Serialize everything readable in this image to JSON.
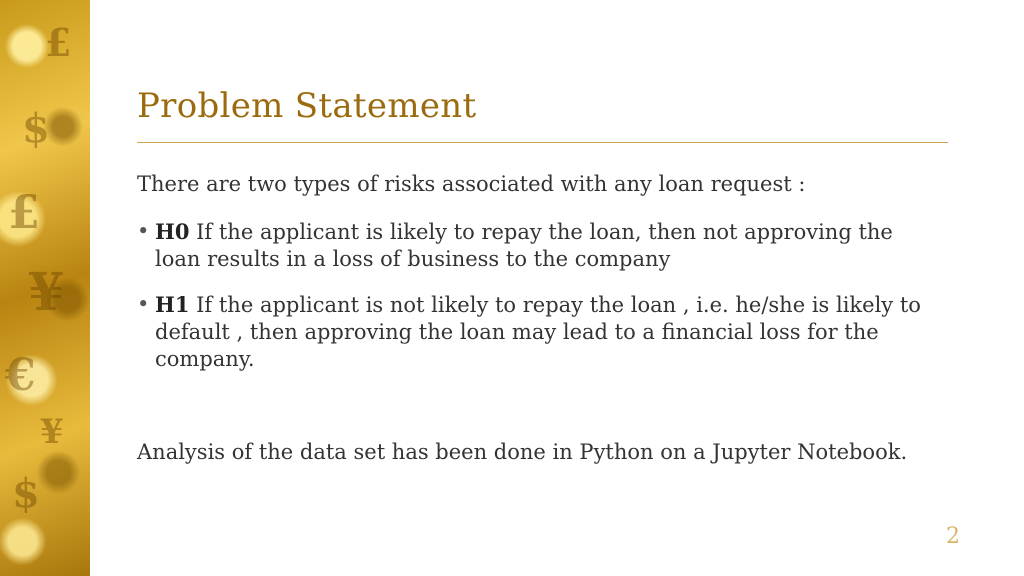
{
  "slide": {
    "title": "Problem Statement",
    "intro": "There are two types of risks associated with any loan request :",
    "bullets": [
      {
        "label": "H0",
        "text": " If the applicant is likely to repay the loan, then not approving the loan results in a loss of business to the company"
      },
      {
        "label": "H1",
        "text": " If the applicant is not likely to repay the loan , i.e. he/she is likely to default , then approving the loan may lead to a financial loss for the company."
      }
    ],
    "outro": "Analysis of the data set has been done in Python on a Jupyter Notebook.",
    "page_number": "2"
  },
  "colors": {
    "title": "#9b6b0f",
    "rule": "#c9a24a",
    "body_text": "#333333",
    "page_number": "#d9b46a",
    "side_band": "#e0b030"
  }
}
